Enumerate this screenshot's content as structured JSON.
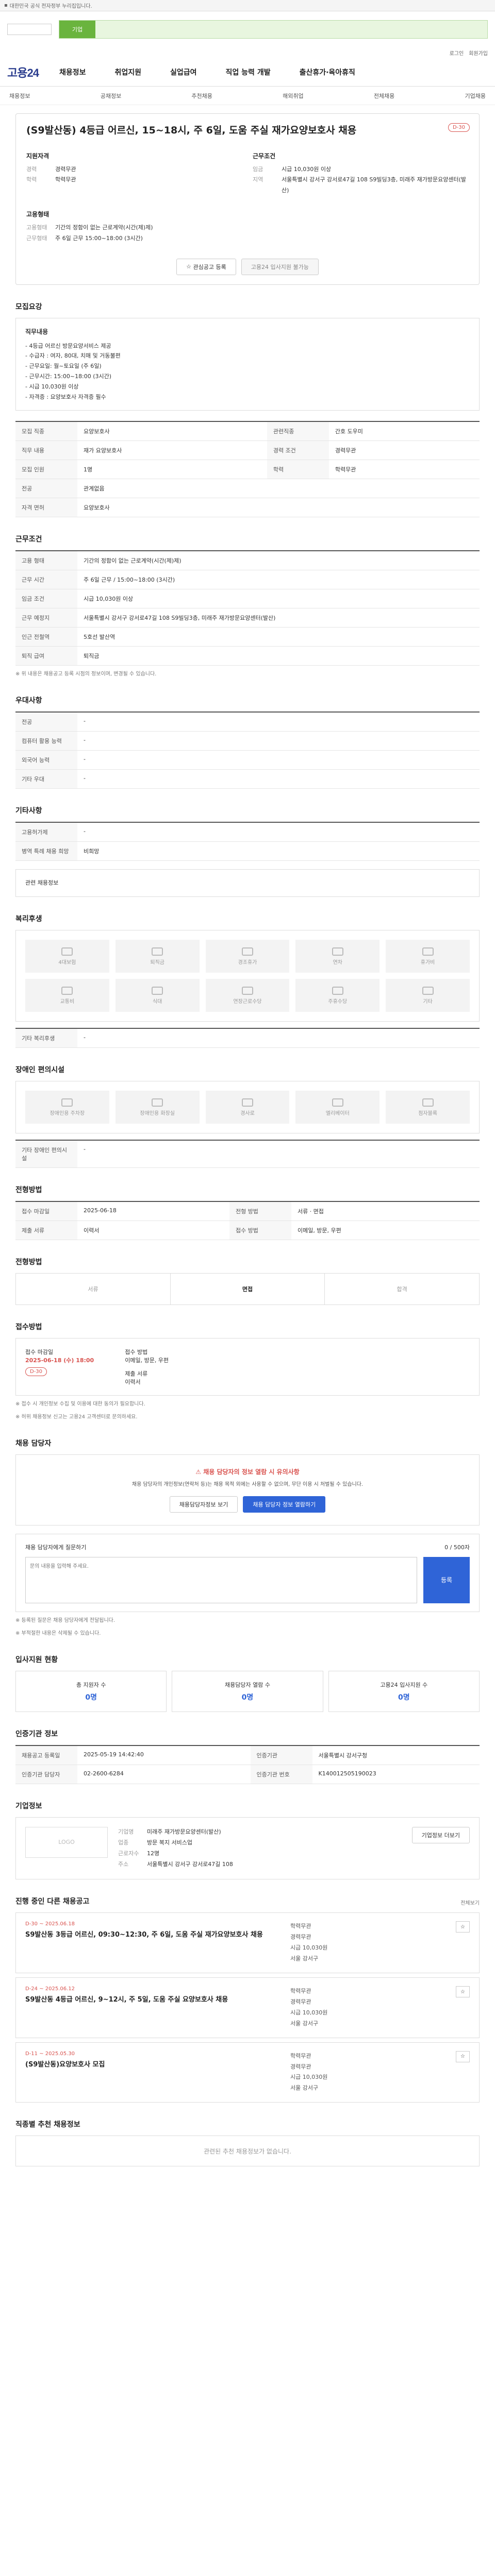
{
  "topbar": {
    "message": "대한민국 공식 전자정부 누리집입니다."
  },
  "search": {
    "tab": "기업",
    "placeholder": ""
  },
  "util": [
    "로그인",
    "회원가입"
  ],
  "gnb": {
    "brand": "고용24",
    "menu": [
      "채용정보",
      "취업지원",
      "실업급여",
      "직업 능력 개발",
      "출산휴가·육아휴직"
    ]
  },
  "subnav": {
    "left": [
      "채용정보",
      "공채정보",
      "추천채용",
      "해외취업",
      "전체채용"
    ],
    "right": "기업채용"
  },
  "job": {
    "title": "(S9발산동) 4등급 어르신, 15~18시, 주 6일, 도움 주실 재가요양보호사 채용",
    "tag": "D-30",
    "summary_left_title": "지원자격",
    "summary_left": [
      {
        "k": "경력",
        "v": "경력무관"
      },
      {
        "k": "학력",
        "v": "학력무관"
      }
    ],
    "summary_right_title": "근무조건",
    "summary_right": [
      {
        "k": "임금",
        "v": "시급 10,030원 이상"
      },
      {
        "k": "지역",
        "v": "서울특별시 강서구 강서로47길 108 S9빌딩3층, 미래주 재가방문요양센터(발산)"
      }
    ],
    "meta_title": "고용형태",
    "meta": [
      {
        "k": "고용형태",
        "v": "기간의 정함이 없는 근로계약(시간(제)제)"
      },
      {
        "k": "근무형태",
        "v": "주 6일 근무 15:00~18:00 (3시간)"
      }
    ],
    "btn_interest": "관심공고 등록",
    "btn_apply": "고용24 입사지원 불가능"
  },
  "detail": {
    "section": "모집요강",
    "box_title": "직무내용",
    "box_lines": [
      "- 4등급 어르신 방문요양서비스 제공",
      "- 수급자 : 여자, 80대, 치매 및 거동불편",
      "- 근무요일: 월~토요일 (주 6일)",
      "- 근무시간: 15:00~18:00 (3시간)",
      "- 시급 10,030원 이상",
      "- 자격증 : 요양보호사 자격증 필수"
    ]
  },
  "info_table": [
    {
      "k": "모집 직종",
      "v": "요양보호사",
      "k2": "관련직종",
      "v2": "간호 도우미"
    },
    {
      "k": "직무 내용",
      "v": "재가 요양보호사",
      "k2": "경력 조건",
      "v2": "경력무관"
    },
    {
      "k": "모집 인원",
      "v": "1명",
      "k2": "학력",
      "v2": "학력무관"
    },
    {
      "k": "전공",
      "v": "관계없음",
      "k2": "",
      "v2": ""
    },
    {
      "k": "자격 면허",
      "v": "요양보호사",
      "k2": "",
      "v2": ""
    }
  ],
  "work_table": [
    {
      "k": "고용 형태",
      "v": "기간의 정함이 없는 근로계약(시간(제)제)"
    },
    {
      "k": "근무 시간",
      "v": "주 6일 근무 / 15:00~18:00 (3시간)"
    },
    {
      "k": "임금 조건",
      "v": "시급 10,030원 이상"
    },
    {
      "k": "근무 예정지",
      "v": "서울특별시 강서구 강서로47길 108 S9빌딩3층, 미래주 재가방문요양센터(발산)"
    },
    {
      "k": "인근 전철역",
      "v": "5호선 발산역"
    },
    {
      "k": "퇴직 급여",
      "v": "퇴직금"
    }
  ],
  "work_note": "※ 위 내용은 채용공고 등록 시점의 정보이며, 변경될 수 있습니다.",
  "welfare_section": "우대사항",
  "welfare_table": [
    {
      "k": "전공",
      "v": "-"
    },
    {
      "k": "컴퓨터 활용 능력",
      "v": "-"
    },
    {
      "k": "외국어 능력",
      "v": "-"
    },
    {
      "k": "기타 우대",
      "v": "-"
    }
  ],
  "other_section": "기타사항",
  "other_table": [
    {
      "k": "고용허가제",
      "v": "-"
    },
    {
      "k": "병역 특례 채용 희망",
      "v": "비희망"
    }
  ],
  "related": "관련 채용정보",
  "benefit_section": "복리후생",
  "benefits": [
    "4대보험",
    "퇴직금",
    "경조휴가",
    "연차",
    "휴가비",
    "교통비",
    "식대",
    "연장근로수당",
    "주휴수당",
    "기타"
  ],
  "benefit_etc": "기타 복리후생",
  "disabled_section": "장애인 편의시설",
  "disabled": [
    "장애인용 주차장",
    "장애인용 화장실",
    "경사로",
    "엘리베이터",
    "점자블록"
  ],
  "disabled_etc": "기타 장애인 편의시설",
  "process_section": "전형방법",
  "process_table": [
    {
      "k": "접수 마감일",
      "v": "2025-06-18"
    },
    {
      "k": "전형 방법",
      "v": "서류 · 면접"
    },
    {
      "k": "제출 서류",
      "v": "이력서"
    },
    {
      "k": "접수 방법",
      "v": "이메일, 방문, 우편"
    }
  ],
  "flow": [
    "서류",
    "면접",
    "합격"
  ],
  "flow_active": 1,
  "apply_section": "접수방법",
  "deadline": {
    "label": "접수 마감일",
    "date": "2025-06-18 (수) 18:00",
    "tag": "D-30",
    "method_label": "접수 방법",
    "method": "이메일, 방문, 우편",
    "doc_label": "제출 서류",
    "doc": "이력서"
  },
  "apply_notes": [
    "※ 접수 시 개인정보 수집 및 이용에 대한 동의가 필요합니다.",
    "※ 허위 채용정보 신고는 고용24 고객센터로 문의하세요."
  ],
  "report_section": "채용 담당자",
  "warn": {
    "title": "채용 담당자의 정보 열람 시 유의사항",
    "body": "채용 담당자의 개인정보(연락처 등)는 채용 목적 외에는 사용할 수 없으며, 무단 이용 시 처벌될 수 있습니다.",
    "btn1": "채용담당자정보 보기",
    "btn2": "채용 담당자 정보 열람하기"
  },
  "inquiry": {
    "label": "채용 담당자에게 질문하기",
    "count": "0 / 500자",
    "placeholder": "문의 내용을 입력해 주세요.",
    "send": "등록"
  },
  "inquiry_notes": [
    "※ 등록된 질문은 채용 담당자에게 전달됩니다.",
    "※ 부적절한 내용은 삭제될 수 있습니다."
  ],
  "stats_section": "입사지원 현황",
  "stats": [
    {
      "label": "총 지원자 수",
      "n": "0명"
    },
    {
      "label": "채용담당자 열람 수",
      "n": "0명"
    },
    {
      "label": "고용24 입사지원 수",
      "n": "0명"
    }
  ],
  "manage_section": "인증기관 정보",
  "manage_table": [
    {
      "k": "채용공고 등록일",
      "v": "2025-05-19 14:42:40",
      "k2": "인증기관",
      "v2": "서울특별시 강서구청"
    },
    {
      "k": "인증기관 담당자",
      "v": "02-2600-6284",
      "k2": "인증기관 번호",
      "v2": "K140012505190023"
    }
  ],
  "company_section": "기업정보",
  "company": {
    "logo": "LOGO",
    "name": "미래주 재가방문요양센터(발산)",
    "rows": [
      {
        "k": "기업명",
        "v": "미래주 재가방문요양센터(발산)"
      },
      {
        "k": "업종",
        "v": "방문 복지 서비스업"
      },
      {
        "k": "근로자수",
        "v": "12명"
      },
      {
        "k": "주소",
        "v": "서울특별시 강서구 강서로47길 108"
      }
    ],
    "btn": "기업정보 더보기"
  },
  "other_jobs_section": "진행 중인 다른 채용공고",
  "other_jobs_more": "전체보기",
  "other_jobs": [
    {
      "d": "D-30",
      "date": "~ 2025.06.18",
      "title": "S9발산동 3등급 어르신, 09:30~12:30, 주 6일, 도움 주실 재가요양보호사 채용",
      "meta": [
        "학력무관",
        "경력무관",
        "시급 10,030원",
        "서울 강서구"
      ]
    },
    {
      "d": "D-24",
      "date": "~ 2025.06.12",
      "title": "S9발산동 4등급 어르신, 9~12시, 주 5일, 도움 주실 요양보호사 채용",
      "meta": [
        "학력무관",
        "경력무관",
        "시급 10,030원",
        "서울 강서구"
      ]
    },
    {
      "d": "D-11",
      "date": "~ 2025.05.30",
      "title": "(S9발산동)요양보호사 모집",
      "meta": [
        "학력무관",
        "경력무관",
        "시급 10,030원",
        "서울 강서구"
      ]
    }
  ],
  "last_section": "직종별 추천 채용정보",
  "last_empty": "관련된 추천 채용정보가 없습니다."
}
